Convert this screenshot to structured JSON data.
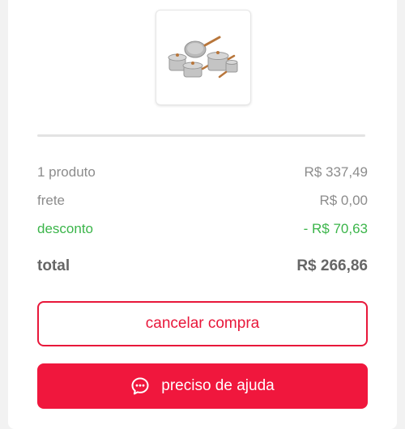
{
  "product": {
    "image_icon": "cookware-set-image"
  },
  "summary": {
    "products_label": "1 produto",
    "products_value": "R$ 337,49",
    "shipping_label": "frete",
    "shipping_value": "R$ 0,00",
    "discount_label": "desconto",
    "discount_value": "- R$ 70,63",
    "total_label": "total",
    "total_value": "R$ 266,86"
  },
  "actions": {
    "cancel_label": "cancelar compra",
    "help_label": "preciso de ajuda",
    "help_icon": "chat-bubble-icon"
  },
  "colors": {
    "accent": "#f0173d",
    "discount": "#3bb54a",
    "muted_text": "#8c8c8c"
  }
}
